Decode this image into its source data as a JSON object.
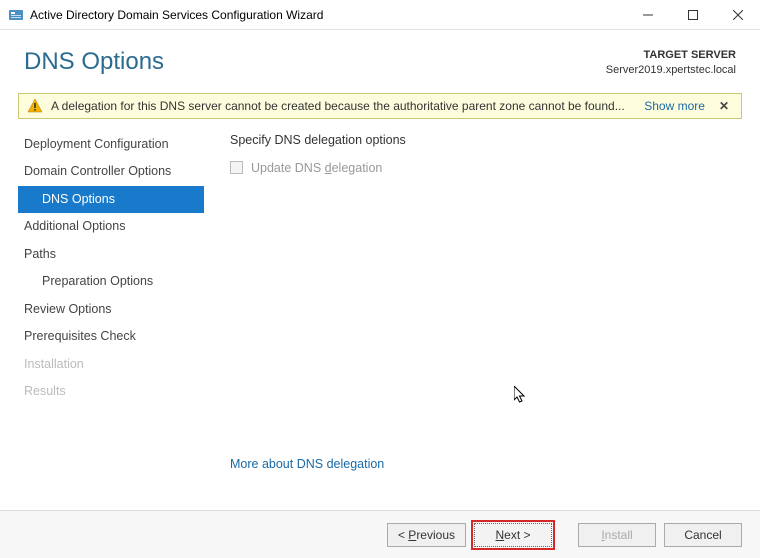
{
  "window": {
    "title": "Active Directory Domain Services Configuration Wizard"
  },
  "header": {
    "page_title": "DNS Options",
    "target_label": "TARGET SERVER",
    "target_value": "Server2019.xpertstec.local"
  },
  "warning": {
    "message": "A delegation for this DNS server cannot be created because the authoritative parent zone cannot be found...",
    "show_more": "Show more",
    "close": "✕"
  },
  "sidebar": {
    "items": [
      {
        "label": "Deployment Configuration",
        "selected": false,
        "disabled": false,
        "indent": false
      },
      {
        "label": "Domain Controller Options",
        "selected": false,
        "disabled": false,
        "indent": false
      },
      {
        "label": "DNS Options",
        "selected": true,
        "disabled": false,
        "indent": true
      },
      {
        "label": "Additional Options",
        "selected": false,
        "disabled": false,
        "indent": false
      },
      {
        "label": "Paths",
        "selected": false,
        "disabled": false,
        "indent": false
      },
      {
        "label": "Preparation Options",
        "selected": false,
        "disabled": false,
        "indent": true
      },
      {
        "label": "Review Options",
        "selected": false,
        "disabled": false,
        "indent": false
      },
      {
        "label": "Prerequisites Check",
        "selected": false,
        "disabled": false,
        "indent": false
      },
      {
        "label": "Installation",
        "selected": false,
        "disabled": true,
        "indent": false
      },
      {
        "label": "Results",
        "selected": false,
        "disabled": true,
        "indent": false
      }
    ]
  },
  "content": {
    "heading": "Specify DNS delegation options",
    "checkbox_pre": "Update DNS ",
    "checkbox_u": "d",
    "checkbox_post": "elegation",
    "checkbox_checked": false,
    "more_link": "More about DNS delegation"
  },
  "footer": {
    "previous_pre": "< ",
    "previous_u": "P",
    "previous_post": "revious",
    "next_u": "N",
    "next_post": "ext >",
    "install_u": "I",
    "install_post": "nstall",
    "cancel": "Cancel"
  }
}
